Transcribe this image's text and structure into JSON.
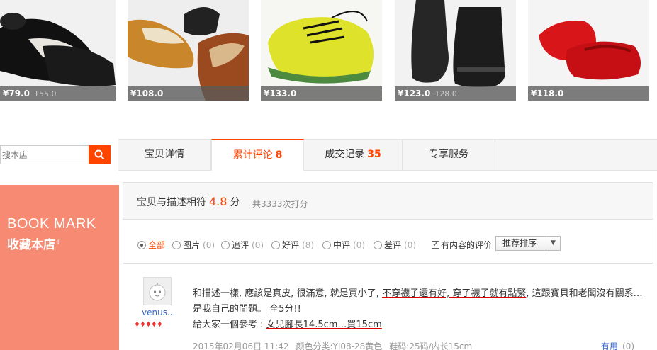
{
  "products": [
    {
      "price": "¥79.0",
      "old_price": "155.0"
    },
    {
      "price": "¥108.0",
      "old_price": ""
    },
    {
      "price": "¥133.0",
      "old_price": ""
    },
    {
      "price": "¥123.0",
      "old_price": "128.0"
    },
    {
      "price": "¥118.0",
      "old_price": ""
    }
  ],
  "search": {
    "placeholder": "搜本店"
  },
  "tabs": [
    {
      "label": "宝贝详情",
      "count": ""
    },
    {
      "label": "累计评论",
      "count": "8"
    },
    {
      "label": "成交记录",
      "count": "35"
    },
    {
      "label": "专享服务",
      "count": ""
    }
  ],
  "bookmark": {
    "en": "BOOK MARK",
    "cn": "收藏本店",
    "plus": "+"
  },
  "rating": {
    "label": "宝贝与描述相符",
    "score": "4.8",
    "unit": "分",
    "total": "共3333次打分"
  },
  "filters": [
    {
      "label": "全部",
      "count": ""
    },
    {
      "label": "图片",
      "count": "(0)"
    },
    {
      "label": "追评",
      "count": "(0)"
    },
    {
      "label": "好评",
      "count": "(8)"
    },
    {
      "label": "中评",
      "count": "(0)"
    },
    {
      "label": "差评",
      "count": "(0)"
    }
  ],
  "content_filter": {
    "label": "有内容的评价",
    "checked": true
  },
  "sort": {
    "selected": "推荐排序"
  },
  "review": {
    "user": "venus...",
    "hearts": "♦♦♦♦♦",
    "line1_a": "和描述一樣, 應該是真皮, 很滿意, 就是買小了, ",
    "line1_u": "不穿襪子還有好, 穿了襪子就有點緊",
    "line1_b": ", 這跟寶貝和老闆沒有關系…是我自己的問題。 全5分!!",
    "line2_a": "給大家一個參考 : ",
    "line2_u": "女兒腳長14.5cm…買15cm",
    "date": "2015年02月06日 11:42",
    "color": "颜色分类:YJ08-28黄色",
    "size": "鞋码:25码/内长15cm",
    "useful_label": "有用",
    "useful_count": "(0)"
  },
  "colors": {
    "accent": "#ff4400",
    "bookmark_bg": "#f78a72"
  }
}
